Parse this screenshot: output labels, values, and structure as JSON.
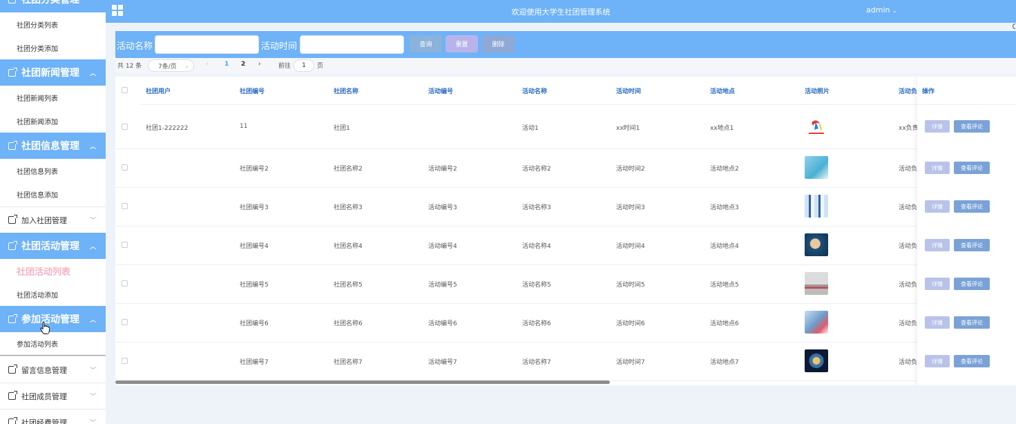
{
  "header": {
    "title": "欢迎使用大学生社团管理系统",
    "user": "admin",
    "user_caret": "⌄"
  },
  "sidebar": {
    "top_group_label": "社团分类管理",
    "groups": [
      {
        "label": "社团分类列表"
      },
      {
        "label": "社团分类添加"
      },
      {
        "label": "社团新闻管理"
      },
      {
        "label": "社团新闻列表"
      },
      {
        "label": "社团新闻添加"
      },
      {
        "label": "社团信息管理"
      },
      {
        "label": "社团信息列表"
      },
      {
        "label": "社团信息添加"
      },
      {
        "label": "加入社团管理"
      },
      {
        "label": "社团活动管理"
      },
      {
        "label": "社团活动列表"
      },
      {
        "label": "社团活动添加"
      },
      {
        "label": "参加活动管理"
      },
      {
        "label": "参加活动列表"
      },
      {
        "label": "留言信息管理"
      },
      {
        "label": "社团成员管理"
      },
      {
        "label": "社团经费管理"
      }
    ]
  },
  "search": {
    "name_label": "活动名称",
    "name_value": "",
    "time_label": "活动时间",
    "time_value": "",
    "query_button": "查询",
    "reset_button": "重置",
    "delete_button": "删除"
  },
  "pager": {
    "total": "共 12 条",
    "page_size": "7条/页",
    "prev": "‹",
    "pages": [
      "1",
      "2"
    ],
    "next": "›",
    "goto_prefix": "前往",
    "goto_value": "1",
    "goto_suffix": "页"
  },
  "table": {
    "columns": [
      "社团用户",
      "社团编号",
      "社团名称",
      "活动编号",
      "活动名称",
      "活动时间",
      "活动地点",
      "活动照片",
      "活动负",
      "操作"
    ],
    "rows": [
      {
        "user": "社团1-222222",
        "club_no": "11",
        "club_name": "社团1",
        "act_no": "",
        "act_name": "活动1",
        "act_time": "xx时间1",
        "act_place": "xx地点1",
        "person": "xx负责"
      },
      {
        "user": "",
        "club_no": "社团编号2",
        "club_name": "社团名称2",
        "act_no": "活动编号2",
        "act_name": "活动名称2",
        "act_time": "活动时间2",
        "act_place": "活动地点2",
        "person": "活动负"
      },
      {
        "user": "",
        "club_no": "社团编号3",
        "club_name": "社团名称3",
        "act_no": "活动编号3",
        "act_name": "活动名称3",
        "act_time": "活动时间3",
        "act_place": "活动地点3",
        "person": "活动负"
      },
      {
        "user": "",
        "club_no": "社团编号4",
        "club_name": "社团名称4",
        "act_no": "活动编号4",
        "act_name": "活动名称4",
        "act_time": "活动时间4",
        "act_place": "活动地点4",
        "person": "活动负"
      },
      {
        "user": "",
        "club_no": "社团编号5",
        "club_name": "社团名称5",
        "act_no": "活动编号5",
        "act_name": "活动名称5",
        "act_time": "活动时间5",
        "act_place": "活动地点5",
        "person": "活动负"
      },
      {
        "user": "",
        "club_no": "社团编号6",
        "club_name": "社团名称6",
        "act_no": "活动编号6",
        "act_name": "活动名称6",
        "act_time": "活动时间6",
        "act_place": "活动地点6",
        "person": "活动负"
      },
      {
        "user": "",
        "club_no": "社团编号7",
        "club_name": "社团名称7",
        "act_no": "活动编号7",
        "act_name": "活动名称7",
        "act_time": "活动时间7",
        "act_place": "活动地点7",
        "person": "活动负"
      }
    ],
    "detail_button": "详情",
    "comment_button": "查看评论"
  },
  "colors": {
    "primary": "#6eb2f8",
    "query_btn": "#8ab2da",
    "reset_btn": "#b9b3ec",
    "delete_btn": "#8fa8d6",
    "detail_btn": "#b9c3ea",
    "comment_btn": "#7aa2d6",
    "active_menu": "#f7b3c2"
  }
}
